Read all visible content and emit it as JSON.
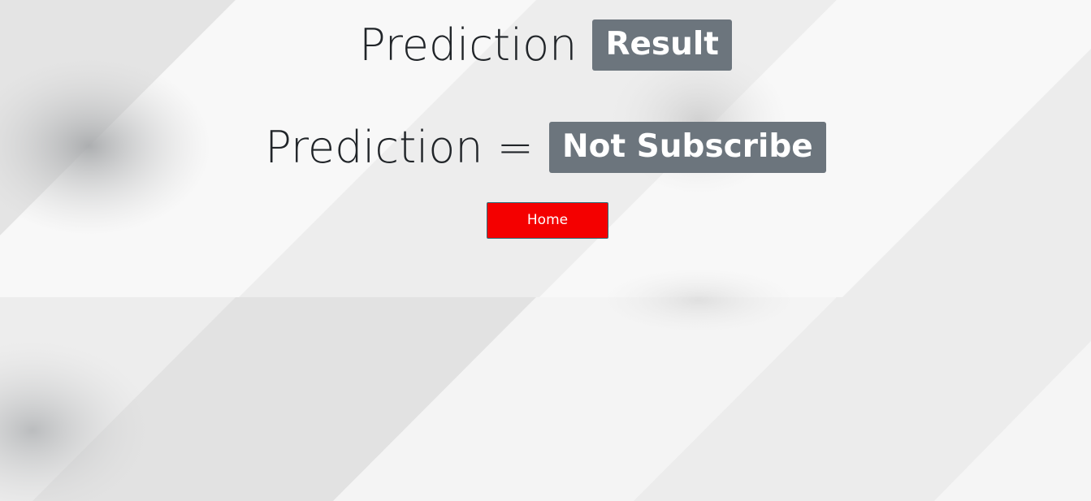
{
  "heading": {
    "label": "Prediction",
    "badge": "Result"
  },
  "prediction": {
    "label": "Prediction =",
    "value": "Not Subscribe"
  },
  "buttons": {
    "home_label": "Home"
  },
  "colors": {
    "badge_bg": "#6c757d",
    "home_button_bg": "#f40000",
    "text": "#212529"
  }
}
